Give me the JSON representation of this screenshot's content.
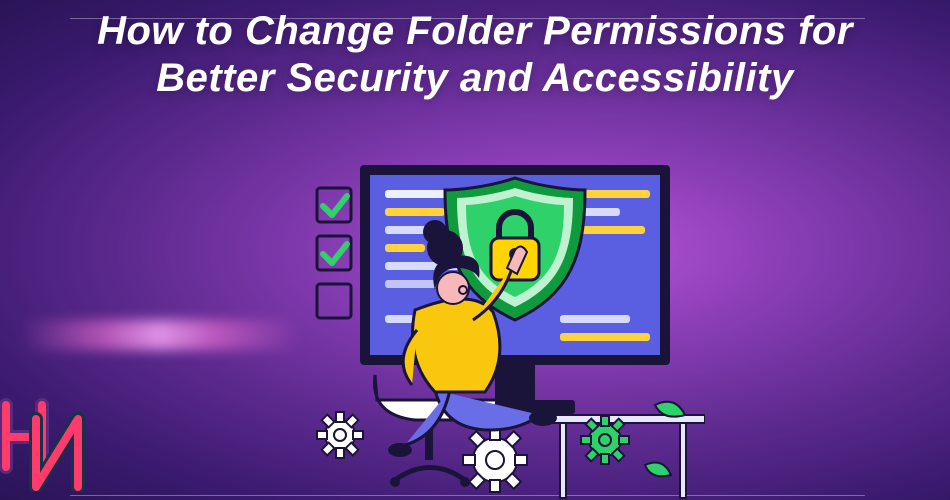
{
  "title": "How to Change Folder Permissions for Better Security and Accessibility",
  "colors": {
    "accent_h": "#ff3b6b",
    "accent_n": "#2de0ff",
    "shield_outer": "#0f9a3e",
    "shield_inner": "#2fd16a",
    "lock": "#ffd400",
    "shirt": "#f9c80e",
    "pants": "#6a6ee6",
    "screen": "#5a5ee0",
    "screen_frame": "#1a143a",
    "check": "#2fd16a",
    "code_yellow": "#ffd23f",
    "code_white": "#eef0ff"
  }
}
